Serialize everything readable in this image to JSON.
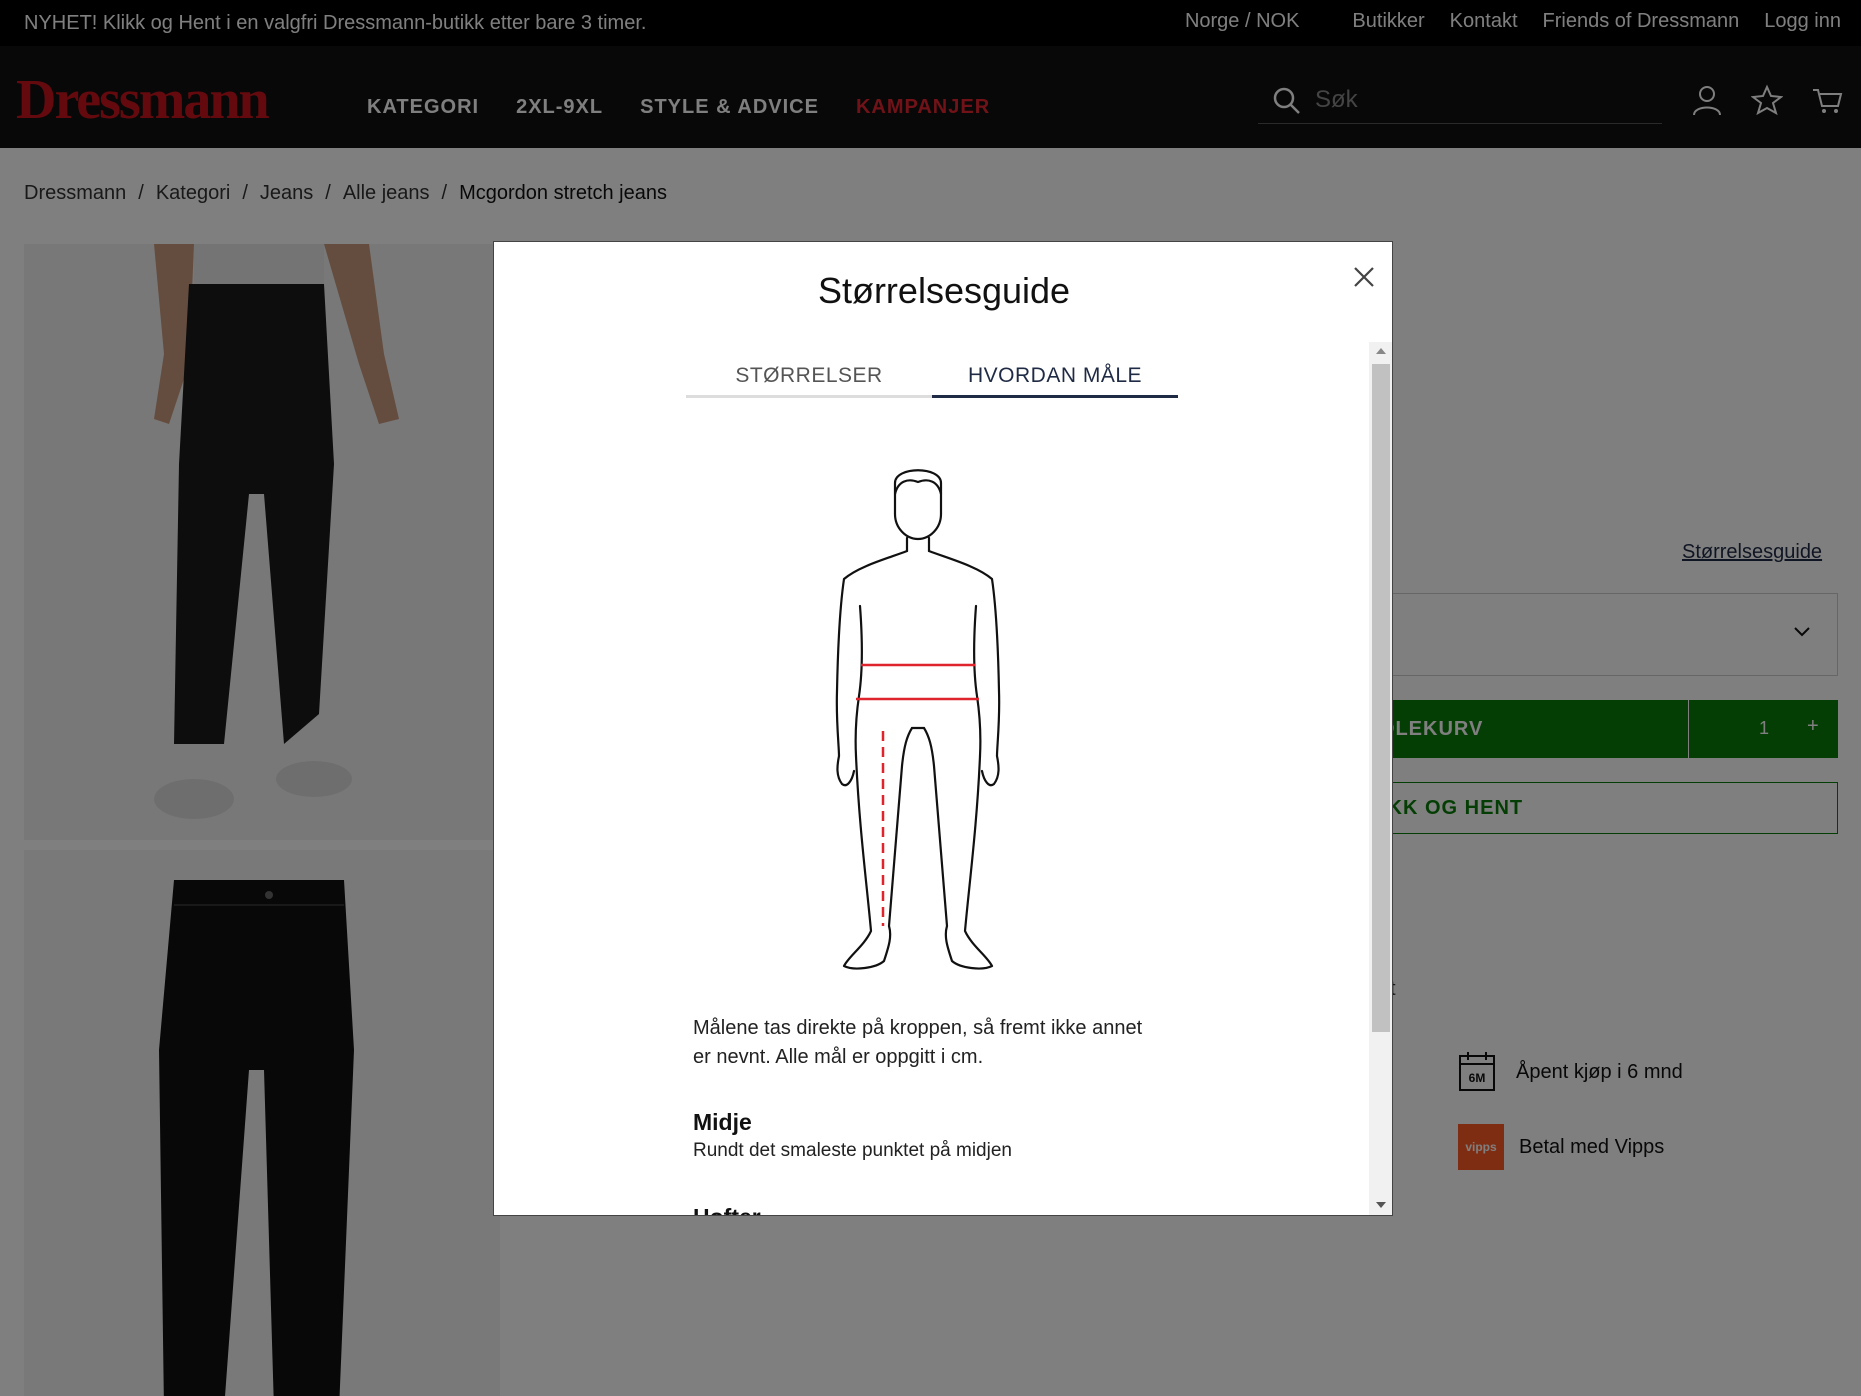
{
  "topbar": {
    "promo": "NYHET! Klikk og Hent i en valgfri Dressmann-butikk etter bare 3 timer.",
    "region": "Norge / NOK",
    "links": [
      "Butikker",
      "Kontakt",
      "Friends of Dressmann",
      "Logg inn"
    ]
  },
  "header": {
    "logo": "Dressmann",
    "nav": [
      "KATEGORI",
      "2XL-9XL",
      "STYLE & ADVICE",
      "KAMPANJER"
    ],
    "search_placeholder": "Søk",
    "icons": [
      "user-icon",
      "star-icon",
      "cart-icon"
    ]
  },
  "breadcrumb": [
    "Dressmann",
    "Kategori",
    "Jeans",
    "Alle jeans",
    "Mcgordon stretch jeans"
  ],
  "product": {
    "size_guide_link": "Størrelsesguide",
    "add_to_cart_partial": "DLEKURV",
    "quantity": "1",
    "plus": "+",
    "click_collect_partial": "IKK OG HENT",
    "partial_char": "t",
    "perks": [
      {
        "icon": "calendar-6m-icon",
        "icon_text": "6M",
        "label": "Åpent kjøp i 6 mnd"
      },
      {
        "icon": "vipps-icon",
        "icon_text": "vipps",
        "label": "Betal med Vipps"
      }
    ]
  },
  "modal": {
    "title": "Størrelsesguide",
    "tabs": [
      {
        "label": "STØRRELSER",
        "active": false
      },
      {
        "label": "HVORDAN MÅLE",
        "active": true
      }
    ],
    "intro": "Målene tas direkte på kroppen, så fremt ikke annet er nevnt. Alle mål er oppgitt i cm.",
    "measurements": [
      {
        "title": "Midje",
        "desc": "Rundt det smaleste punktet på midjen"
      },
      {
        "title": "Hofter",
        "desc": ""
      }
    ]
  },
  "colors": {
    "brand_red": "#c8141c",
    "campaign_red": "#e0242e",
    "cart_green": "#0b7d0b",
    "tab_active": "#1f2a44",
    "measure_line": "#e0242e"
  }
}
